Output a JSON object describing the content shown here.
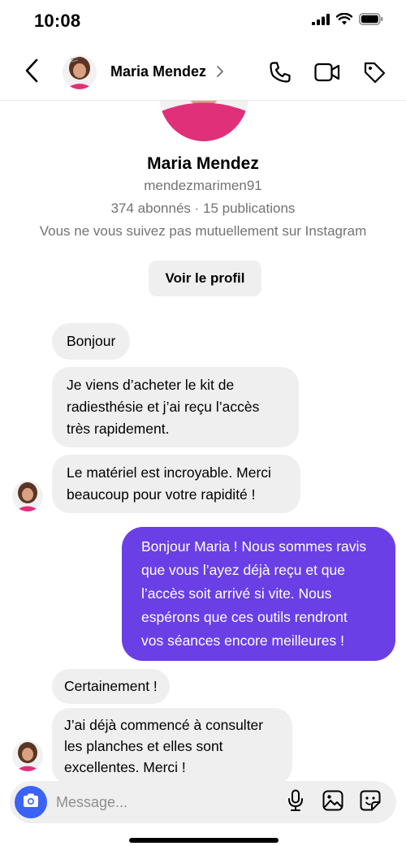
{
  "status_bar": {
    "time": "10:08"
  },
  "header": {
    "name": "Maria Mendez",
    "chevron": "›"
  },
  "profile": {
    "name": "Maria Mendez",
    "username": "mendezmarimen91",
    "stats": "374 abonnés · 15 publications",
    "note": "Vous ne vous suivez pas mutuellement sur Instagram",
    "button_label": "Voir le profil"
  },
  "messages": [
    {
      "direction": "in",
      "lines": [
        "Bonjour"
      ]
    },
    {
      "direction": "in",
      "lines": [
        "Je viens d’acheter le kit de",
        "radiesthésie et j’ai reçu l’accès",
        "très rapidement."
      ]
    },
    {
      "direction": "in",
      "lines": [
        "Le matériel est incroyable. Merci",
        "beaucoup pour votre rapidité !"
      ]
    },
    {
      "direction": "out",
      "lines": [
        "Bonjour Maria ! Nous sommes ravis",
        "que vous l’ayez déjà reçu et que",
        "l’accès soit arrivé si vite. Nous",
        "espérons que ces outils rendront",
        "vos séances encore meilleures !"
      ]
    },
    {
      "direction": "in",
      "lines": [
        "Certainement !"
      ]
    },
    {
      "direction": "in",
      "lines": [
        "J’ai déjà commencé à consulter",
        "les planches et elles sont",
        "excellentes. Merci !"
      ]
    }
  ],
  "composer": {
    "placeholder": "Message..."
  },
  "colors": {
    "outgoing_bubble": "#6a3fe5",
    "incoming_bubble": "#efefef",
    "camera_button": "#3b62f6",
    "secondary_text": "#737373"
  },
  "icons": [
    "back-arrow",
    "phone",
    "video-camera",
    "tag",
    "camera",
    "microphone",
    "image",
    "sticker"
  ]
}
